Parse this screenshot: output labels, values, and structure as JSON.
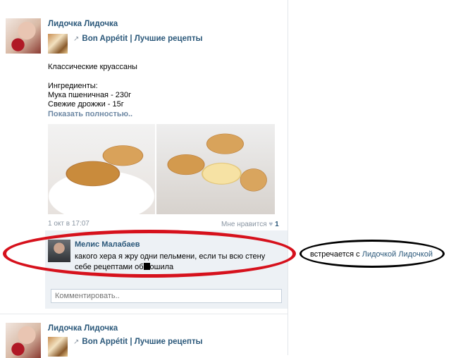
{
  "post1": {
    "author": "Лидочка Лидочка",
    "source": "Bon Appétit | Лучшие рецепты",
    "lines": [
      "Классические круассаны",
      "Ингредиенты:",
      "Мука пшеничная - 230г",
      "Свежие дрожжи - 15г"
    ],
    "show_more": "Показать полностью..",
    "date": "1 окт в 17:07",
    "like_label": "Мне нравится",
    "like_count": "1"
  },
  "comment": {
    "author": "Мелис Малабаев",
    "text_part1": "какого хера я жру одни пельмени, если ты всю стену себе рецептами об",
    "text_part2": "ошила",
    "input_placeholder": "Комментировать.."
  },
  "annotation": {
    "prefix": "встречается с",
    "link": "Лидочкой Лидочкой"
  },
  "post2": {
    "author": "Лидочка Лидочка",
    "source": "Bon Appétit | Лучшие рецепты"
  },
  "icons": {
    "repost": "repost-icon",
    "heart": "heart-icon"
  },
  "colors": {
    "link": "#2b587a",
    "muted": "#8a96a3",
    "comment_bg": "#edf1f5",
    "red_circle": "#d6111c"
  }
}
